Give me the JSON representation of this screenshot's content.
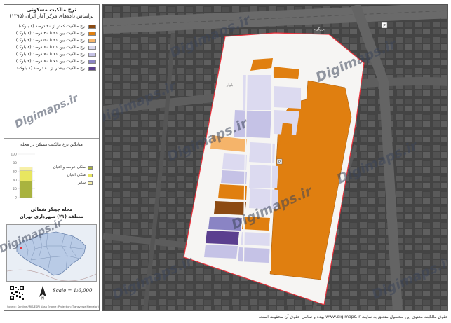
{
  "legend": {
    "title_line1": "نرخ مالکیت مسکونی",
    "title_line2": "براساس داده‌های مرکز آمار ایران (۱۳۹۵)",
    "items": [
      {
        "label": "نرخ مالکیت کمتر از ۳۰ درصد (۱ بلوک)",
        "color": "#8c4a12"
      },
      {
        "label": "نرخ مالکیت بین ۳۱ تا ۴۰ درصد (۶ بلوک)",
        "color": "#e07f10"
      },
      {
        "label": "نرخ مالکیت بین ۴۱ تا ۵۰ درصد (۲ بلوک)",
        "color": "#f5b46a"
      },
      {
        "label": "نرخ مالکیت بین ۵۱ تا ۶۰ درصد (۸ بلوک)",
        "color": "#dcdaf0"
      },
      {
        "label": "نرخ مالکیت بین ۶۱ تا ۷۰ درصد (۶ بلوک)",
        "color": "#c5c2e6"
      },
      {
        "label": "نرخ مالکیت بین ۷۱ تا ۸۰ درصد (۳ بلوک)",
        "color": "#8a84c4"
      },
      {
        "label": "نرخ مالکیت بیشتر از ۸۱ درصد (۱ بلوک)",
        "color": "#5b3f8f"
      }
    ]
  },
  "chart_data": {
    "type": "bar",
    "title": "میانگین نرخ مالکیت مسکن در محله",
    "categories": [
      "محله"
    ],
    "series": [
      {
        "name": "ملکی عرصه و اعیان",
        "values": [
          38
        ],
        "color": "#a9b33f"
      },
      {
        "name": "ملکی اعیان",
        "values": [
          24
        ],
        "color": "#e8e660"
      },
      {
        "name": "سایر",
        "values": [
          8
        ],
        "color": "#f7f0a8"
      }
    ],
    "yticks": [
      "0",
      "20",
      "40",
      "60",
      "80",
      "100"
    ],
    "ylim": [
      0,
      100
    ]
  },
  "place": {
    "line1": "محله چیتگر شمالی",
    "line2": "منطقه (۲۱) شهرداری تهران"
  },
  "scale": "Scale = 1:6,000",
  "credits": "Source: Sentinel/IRIS/ESRI Nasa Engine (Projection: Transverse Mercator)",
  "watermark": "Digimaps.ir",
  "footer": "حقوق مالکیت معنوی این محصول متعلق به سایت www.digimaps.ir بوده و تمامی حقوق آن محفوظ است.",
  "colors": {
    "satellite_bg": "#3b3b3b",
    "boundary": "#e8323c",
    "neighborhood_fill": "#f6f5f3",
    "inset_highlight": "#b9cbe6"
  }
}
